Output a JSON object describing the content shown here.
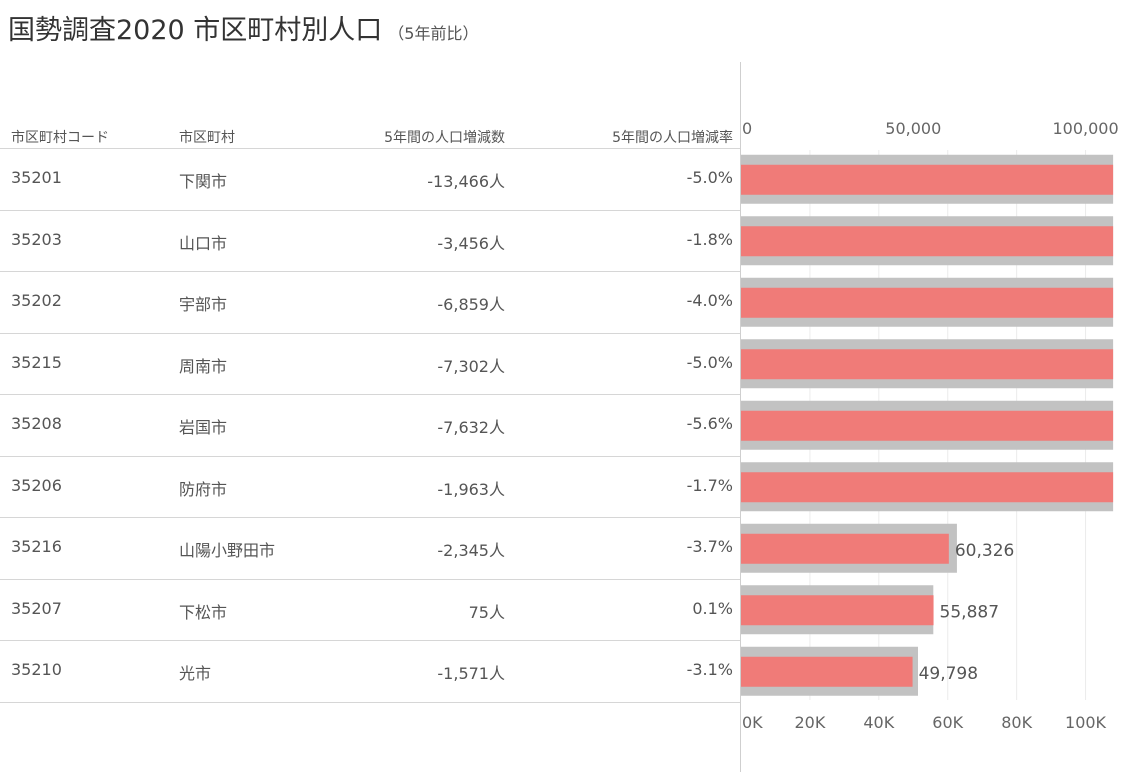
{
  "title": {
    "main": "国勢調査2020 市区町村別人口",
    "sub": "（5年前比）"
  },
  "headers": {
    "code": "市区町村コード",
    "name": "市区町村",
    "delta": "5年間の人口増減数",
    "rate": "5年間の人口増減率"
  },
  "rows": [
    {
      "code": "35201",
      "name": "下関市",
      "delta": "-13,466人",
      "rate": "-5.0%"
    },
    {
      "code": "35203",
      "name": "山口市",
      "delta": "-3,456人",
      "rate": "-1.8%"
    },
    {
      "code": "35202",
      "name": "宇部市",
      "delta": "-6,859人",
      "rate": "-4.0%"
    },
    {
      "code": "35215",
      "name": "周南市",
      "delta": "-7,302人",
      "rate": "-5.0%"
    },
    {
      "code": "35208",
      "name": "岩国市",
      "delta": "-7,632人",
      "rate": "-5.6%"
    },
    {
      "code": "35206",
      "name": "防府市",
      "delta": "-1,963人",
      "rate": "-1.7%"
    },
    {
      "code": "35216",
      "name": "山陽小野田市",
      "delta": "-2,345人",
      "rate": "-3.7%"
    },
    {
      "code": "35207",
      "name": "下松市",
      "delta": "75人",
      "rate": "0.1%"
    },
    {
      "code": "35210",
      "name": "光市",
      "delta": "-1,571人",
      "rate": "-3.1%"
    }
  ],
  "chart_data": {
    "type": "bar",
    "orientation": "horizontal",
    "categories": [
      "下関市",
      "山口市",
      "宇部市",
      "周南市",
      "岩国市",
      "防府市",
      "山陽小野田市",
      "下松市",
      "光市"
    ],
    "series": [
      {
        "role": "current",
        "values": [
          null,
          null,
          null,
          null,
          null,
          null,
          60326,
          55887,
          49798
        ]
      },
      {
        "role": "previous",
        "values": [
          null,
          null,
          null,
          null,
          null,
          null,
          62671,
          55812,
          51369
        ]
      }
    ],
    "value_labels": [
      "",
      "",
      "",
      "",
      "",
      "",
      "60,326",
      "55,887",
      "49,798"
    ],
    "bars_clipped_at": 108000,
    "xlim": [
      0,
      110000
    ],
    "top_axis_ticks": [
      {
        "v": 0,
        "label": "0"
      },
      {
        "v": 50000,
        "label": "50,000"
      },
      {
        "v": 100000,
        "label": "100,000"
      }
    ],
    "bottom_axis_ticks": [
      {
        "v": 0,
        "label": "0K"
      },
      {
        "v": 20000,
        "label": "20K"
      },
      {
        "v": 40000,
        "label": "40K"
      },
      {
        "v": 60000,
        "label": "60K"
      },
      {
        "v": 80000,
        "label": "80K"
      },
      {
        "v": 100000,
        "label": "100K"
      }
    ],
    "colors": {
      "current": "#f07b78",
      "previous": "#c2c2c2",
      "grid": "#ececec"
    }
  }
}
